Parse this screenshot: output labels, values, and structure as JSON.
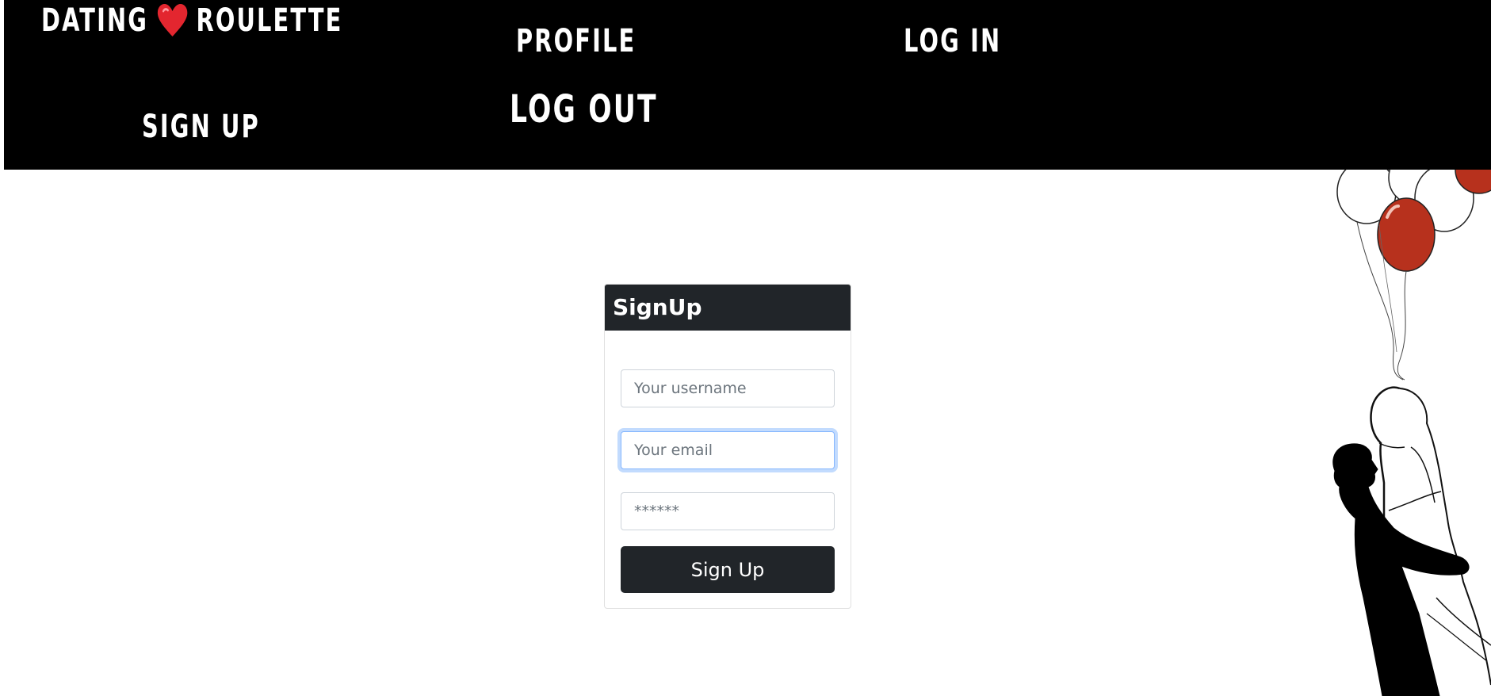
{
  "nav": {
    "brand_left": "DATING",
    "brand_right": "ROULETTE",
    "profile": "PROFILE",
    "login": "LOG IN",
    "signup": "SIGN UP",
    "logout": "LOG OUT"
  },
  "signup_card": {
    "title": "SignUp",
    "username_placeholder": "Your username",
    "email_placeholder": "Your email",
    "password_placeholder": "******",
    "submit_label": "Sign Up"
  },
  "icons": {
    "brand": "heart-icon",
    "illustration": "couple-with-balloons-illustration"
  },
  "colors": {
    "navbar_bg": "#000000",
    "card_header_bg": "#212529",
    "button_bg": "#212529",
    "heart": "#e3262f",
    "balloon_red": "#b7311d",
    "focus_ring": "#86b7fe"
  }
}
